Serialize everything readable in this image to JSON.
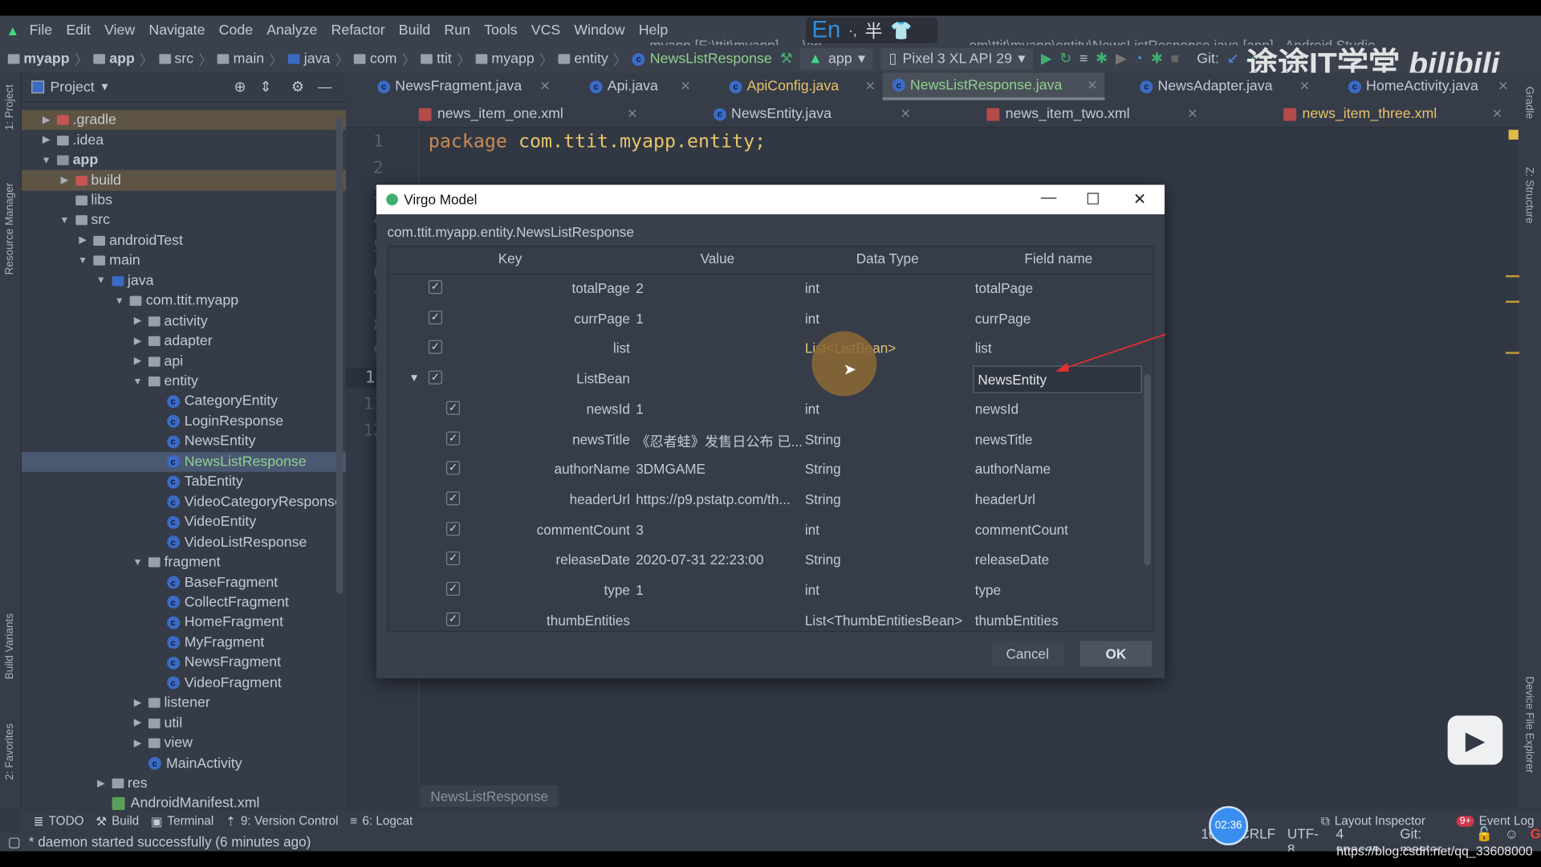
{
  "menu": {
    "items": [
      "File",
      "Edit",
      "View",
      "Navigate",
      "Code",
      "Analyze",
      "Refactor",
      "Build",
      "Run",
      "Tools",
      "VCS",
      "Window",
      "Help"
    ]
  },
  "window_title": "myapp [E:\\ttit\\myapp] - ...\\ap",
  "window_title_rest": "om\\ttit\\myapp\\entity\\NewsListResponse.java [app] - Android Studio",
  "ime": {
    "lang": "En",
    "punct": "·,",
    "width": "半"
  },
  "breadcrumb": [
    "myapp",
    "app",
    "src",
    "main",
    "java",
    "com",
    "ttit",
    "myapp",
    "entity",
    "NewsListResponse"
  ],
  "toolbar": {
    "run_config": "app",
    "device": "Pixel 3 XL API 29",
    "git_label": "Git:"
  },
  "side_tools": {
    "left": [
      "1: Project",
      "Resource Manager",
      "Build Variants",
      "2: Favorites"
    ],
    "right": [
      "Gradle",
      "Z: Structure",
      "Device File Explorer"
    ]
  },
  "project": {
    "title": "Project",
    "tree": [
      {
        "label": ".gradle",
        "lvl": 0,
        "arrow": "right",
        "icon": "folder-red",
        "bg": "brown"
      },
      {
        "label": ".idea",
        "lvl": 0,
        "arrow": "right",
        "icon": "folder"
      },
      {
        "label": "app",
        "lvl": 0,
        "arrow": "down",
        "icon": "module",
        "bold": true
      },
      {
        "label": "build",
        "lvl": 1,
        "arrow": "right",
        "icon": "folder-red",
        "bg": "brown"
      },
      {
        "label": "libs",
        "lvl": 1,
        "icon": "folder"
      },
      {
        "label": "src",
        "lvl": 1,
        "arrow": "down",
        "icon": "folder"
      },
      {
        "label": "androidTest",
        "lvl": 2,
        "arrow": "right",
        "icon": "folder"
      },
      {
        "label": "main",
        "lvl": 2,
        "arrow": "down",
        "icon": "folder"
      },
      {
        "label": "java",
        "lvl": 3,
        "arrow": "down",
        "icon": "folder-blue"
      },
      {
        "label": "com.ttit.myapp",
        "lvl": 4,
        "arrow": "down",
        "icon": "package"
      },
      {
        "label": "activity",
        "lvl": 5,
        "arrow": "right",
        "icon": "package"
      },
      {
        "label": "adapter",
        "lvl": 5,
        "arrow": "right",
        "icon": "package"
      },
      {
        "label": "api",
        "lvl": 5,
        "arrow": "right",
        "icon": "package"
      },
      {
        "label": "entity",
        "lvl": 5,
        "arrow": "down",
        "icon": "package"
      },
      {
        "label": "CategoryEntity",
        "lvl": 6,
        "icon": "class"
      },
      {
        "label": "LoginResponse",
        "lvl": 6,
        "icon": "class"
      },
      {
        "label": "NewsEntity",
        "lvl": 6,
        "icon": "class"
      },
      {
        "label": "NewsListResponse",
        "lvl": 6,
        "icon": "class",
        "selected": true
      },
      {
        "label": "TabEntity",
        "lvl": 6,
        "icon": "class"
      },
      {
        "label": "VideoCategoryResponse",
        "lvl": 6,
        "icon": "class"
      },
      {
        "label": "VideoEntity",
        "lvl": 6,
        "icon": "class"
      },
      {
        "label": "VideoListResponse",
        "lvl": 6,
        "icon": "class"
      },
      {
        "label": "fragment",
        "lvl": 5,
        "arrow": "down",
        "icon": "package"
      },
      {
        "label": "BaseFragment",
        "lvl": 6,
        "icon": "class"
      },
      {
        "label": "CollectFragment",
        "lvl": 6,
        "icon": "class"
      },
      {
        "label": "HomeFragment",
        "lvl": 6,
        "icon": "class"
      },
      {
        "label": "MyFragment",
        "lvl": 6,
        "icon": "class"
      },
      {
        "label": "NewsFragment",
        "lvl": 6,
        "icon": "class"
      },
      {
        "label": "VideoFragment",
        "lvl": 6,
        "icon": "class"
      },
      {
        "label": "listener",
        "lvl": 5,
        "arrow": "right",
        "icon": "package"
      },
      {
        "label": "util",
        "lvl": 5,
        "arrow": "right",
        "icon": "package"
      },
      {
        "label": "view",
        "lvl": 5,
        "arrow": "right",
        "icon": "package"
      },
      {
        "label": "MainActivity",
        "lvl": 5,
        "icon": "class"
      },
      {
        "label": "res",
        "lvl": 3,
        "arrow": "right",
        "icon": "folder"
      },
      {
        "label": "AndroidManifest.xml",
        "lvl": 3,
        "icon": "manifest"
      }
    ]
  },
  "tabs_row1": [
    {
      "label": "NewsFragment.java",
      "icon": "class"
    },
    {
      "label": "Api.java",
      "icon": "class"
    },
    {
      "label": "ApiConfig.java",
      "icon": "class",
      "color": "#e8c46a"
    },
    {
      "label": "NewsListResponse.java",
      "icon": "class",
      "active": true,
      "color": "#8fd18f"
    },
    {
      "label": "NewsAdapter.java",
      "icon": "class"
    },
    {
      "label": "HomeActivity.java",
      "icon": "class"
    }
  ],
  "tabs_row2": [
    {
      "label": "news_item_one.xml",
      "icon": "xml"
    },
    {
      "label": "NewsEntity.java",
      "icon": "class"
    },
    {
      "label": "news_item_two.xml",
      "icon": "xml"
    },
    {
      "label": "news_item_three.xml",
      "icon": "xml",
      "color": "#e8c46a"
    }
  ],
  "editor": {
    "line_numbers": [
      "1",
      "2",
      "3",
      "4",
      "5",
      "6",
      "7",
      "8",
      "9",
      "10",
      "11",
      "12"
    ],
    "current_line": "10",
    "keyword": "package",
    "code_rest": " com.ttit.myapp.entity;",
    "breadcrumb": "NewsListResponse"
  },
  "dialog": {
    "title": "Virgo Model",
    "class_name": "com.ttit.myapp.entity.NewsListResponse",
    "columns": [
      "Key",
      "Value",
      "Data Type",
      "Field name"
    ],
    "rows": [
      {
        "key": "totalPage",
        "value": "2",
        "type": "int",
        "field": "totalPage",
        "checked": true,
        "child": false
      },
      {
        "key": "currPage",
        "value": "1",
        "type": "int",
        "field": "currPage",
        "checked": true,
        "child": false
      },
      {
        "key": "list",
        "value": "",
        "type": "List<ListBean>",
        "field": "list",
        "checked": true,
        "child": false
      },
      {
        "key": "ListBean",
        "value": "",
        "type": "",
        "field": "NewsEntity",
        "checked": true,
        "child": false,
        "expand": true,
        "editing": true
      },
      {
        "key": "newsId",
        "value": "1",
        "type": "int",
        "field": "newsId",
        "checked": true,
        "child": true
      },
      {
        "key": "newsTitle",
        "value": "《忍者蛙》发售日公布 已...",
        "type": "String",
        "field": "newsTitle",
        "checked": true,
        "child": true
      },
      {
        "key": "authorName",
        "value": "3DMGAME",
        "type": "String",
        "field": "authorName",
        "checked": true,
        "child": true
      },
      {
        "key": "headerUrl",
        "value": "https://p9.pstatp.com/th...",
        "type": "String",
        "field": "headerUrl",
        "checked": true,
        "child": true
      },
      {
        "key": "commentCount",
        "value": "3",
        "type": "int",
        "field": "commentCount",
        "checked": true,
        "child": true
      },
      {
        "key": "releaseDate",
        "value": "2020-07-31 22:23:00",
        "type": "String",
        "field": "releaseDate",
        "checked": true,
        "child": true
      },
      {
        "key": "type",
        "value": "1",
        "type": "int",
        "field": "type",
        "checked": true,
        "child": true
      },
      {
        "key": "thumbEntities",
        "value": "",
        "type": "List<ThumbEntitiesBean>",
        "field": "thumbEntities",
        "checked": true,
        "child": true
      }
    ],
    "cancel": "Cancel",
    "ok": "OK"
  },
  "tool_windows": [
    "TODO",
    "Build",
    "Terminal",
    "9: Version Control",
    "6: Logcat"
  ],
  "tool_windows_right": [
    "Layout Inspector",
    "Event Log"
  ],
  "event_badge": "9+",
  "status": {
    "message": "* daemon started successfully (6 minutes ago)",
    "position": "10:9",
    "line_sep": "CRLF",
    "encoding": "UTF-8",
    "indent": "4 spaces",
    "git": "Git: master"
  },
  "overlay": {
    "timer": "02:36",
    "watermark": "途途IT学堂 bilibili",
    "url": "https://blog.csdn.net/qq_33608000"
  },
  "colors": {
    "accent_green": "#8fd18f",
    "keyword": "#cc8a55",
    "string": "#e8c46a",
    "selection": "#4b5872",
    "annotation_arrow": "#e03030"
  }
}
